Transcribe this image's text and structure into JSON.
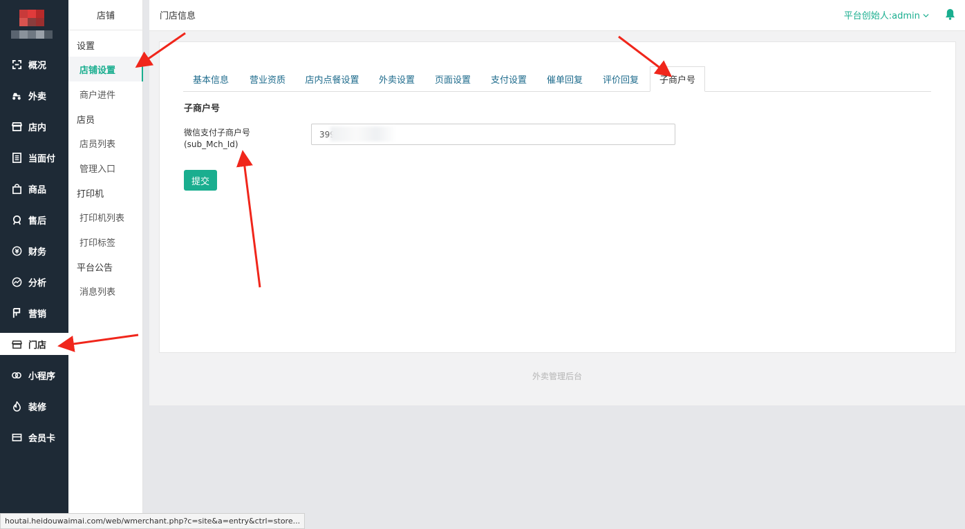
{
  "nav": {
    "items": [
      {
        "label": "概况",
        "icon": "overview-icon"
      },
      {
        "label": "外卖",
        "icon": "delivery-icon"
      },
      {
        "label": "店内",
        "icon": "store-icon"
      },
      {
        "label": "当面付",
        "icon": "pay-icon"
      },
      {
        "label": "商品",
        "icon": "goods-icon"
      },
      {
        "label": "售后",
        "icon": "aftersale-icon"
      },
      {
        "label": "财务",
        "icon": "finance-icon"
      },
      {
        "label": "分析",
        "icon": "analysis-icon"
      },
      {
        "label": "营销",
        "icon": "marketing-icon"
      },
      {
        "label": "门店",
        "icon": "shop-icon"
      },
      {
        "label": "小程序",
        "icon": "miniprogram-icon"
      },
      {
        "label": "装修",
        "icon": "decorate-icon"
      },
      {
        "label": "会员卡",
        "icon": "member-card-icon"
      }
    ],
    "active_index": 9
  },
  "sub": {
    "heading": "店铺",
    "group_settings": "设置",
    "link_store_settings": "店铺设置",
    "link_merchant_apply": "商户进件",
    "group_staff": "店员",
    "link_staff_list": "店员列表",
    "link_admin_entry": "管理入口",
    "group_printer": "打印机",
    "link_printer_list": "打印机列表",
    "link_print_label": "打印标签",
    "group_notice": "平台公告",
    "link_message_list": "消息列表"
  },
  "topbar": {
    "title": "门店信息",
    "user": "平台创始人:admin"
  },
  "tabs": [
    "基本信息",
    "营业资质",
    "店内点餐设置",
    "外卖设置",
    "页面设置",
    "支付设置",
    "催单回复",
    "评价回复",
    "子商户号"
  ],
  "active_tab_index": 8,
  "form": {
    "section_title": "子商户号",
    "label_line1": "微信支付子商户号",
    "label_line2": "(sub_Mch_Id)",
    "value": "399",
    "submit_label": "提交"
  },
  "footer": "外卖管理后台",
  "statusbar": "houtai.heidouwaimai.com/web/wmerchant.php?c=site&a=entry&ctrl=store...",
  "colors": {
    "nav_bg": "#1e2a36",
    "accent": "#1aae8f",
    "tab_text": "#1e6b8c",
    "annotation": "#f0261b"
  }
}
